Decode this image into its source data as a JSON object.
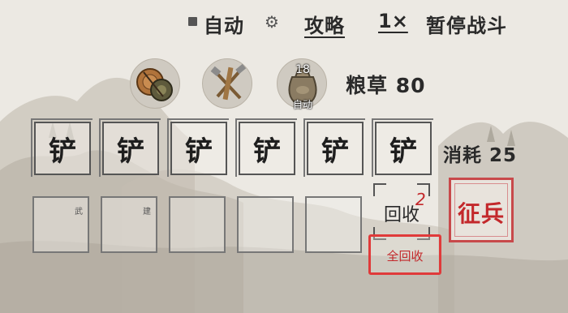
{
  "topbar": {
    "auto_label": "自动",
    "settings_icon": "gear-icon",
    "strategy_label": "攻略",
    "speed_label": "1×",
    "pause_label": "暂停战斗"
  },
  "resources": {
    "items": [
      {
        "icon": "bell-drum-icon"
      },
      {
        "icon": "tools-icon"
      },
      {
        "icon": "grain-sack-icon",
        "count": "18",
        "auto_label": "自动"
      }
    ],
    "grain_label": "粮草 80",
    "cost_label": "消耗 25"
  },
  "top_slots": [
    "铲",
    "铲",
    "铲",
    "铲",
    "铲",
    "铲"
  ],
  "bottom_slots": [
    {
      "tag": "武"
    },
    {
      "tag": "建"
    },
    {
      "tag": ""
    },
    {
      "tag": ""
    },
    {
      "tag": ""
    }
  ],
  "recycle": {
    "label": "回收",
    "badge": "2"
  },
  "recycle_all_label": "全回收",
  "conscript_label": "征兵"
}
